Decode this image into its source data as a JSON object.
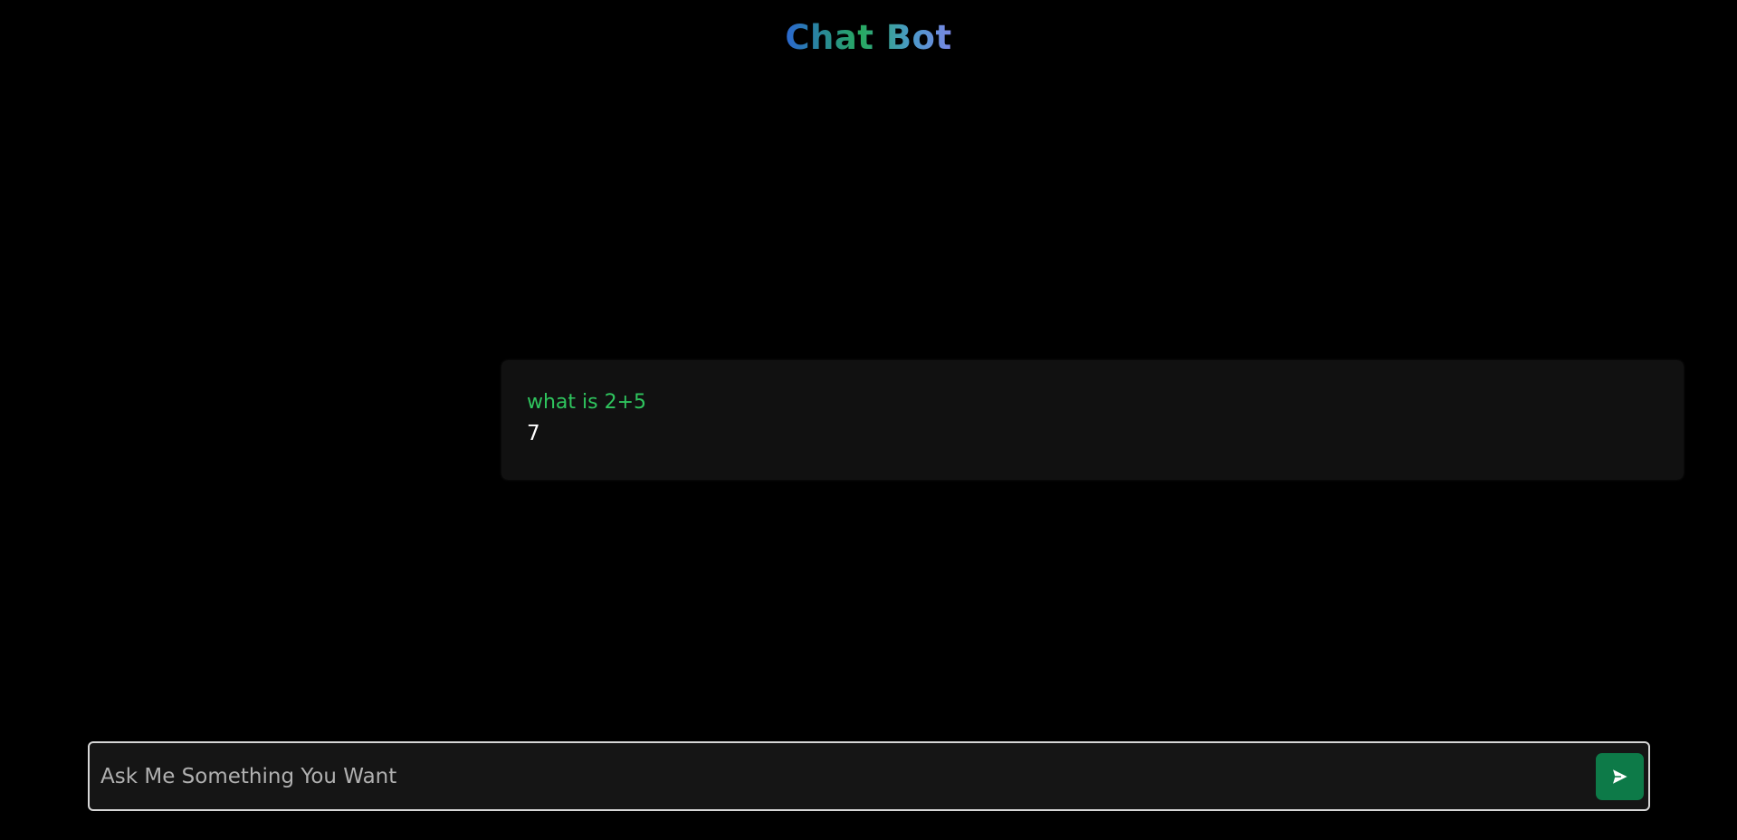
{
  "header": {
    "title": "Chat Bot"
  },
  "messages": [
    {
      "question": "what is 2+5",
      "answer": "7"
    }
  ],
  "composer": {
    "placeholder": "Ask Me Something You Want",
    "value": "",
    "send_icon": "send-icon"
  },
  "colors": {
    "background": "#000000",
    "card": "#111111",
    "question_text": "#2fc55e",
    "answer_text": "#ffffff",
    "send_button": "#0d7a48",
    "input_border": "#d7d7d7"
  }
}
